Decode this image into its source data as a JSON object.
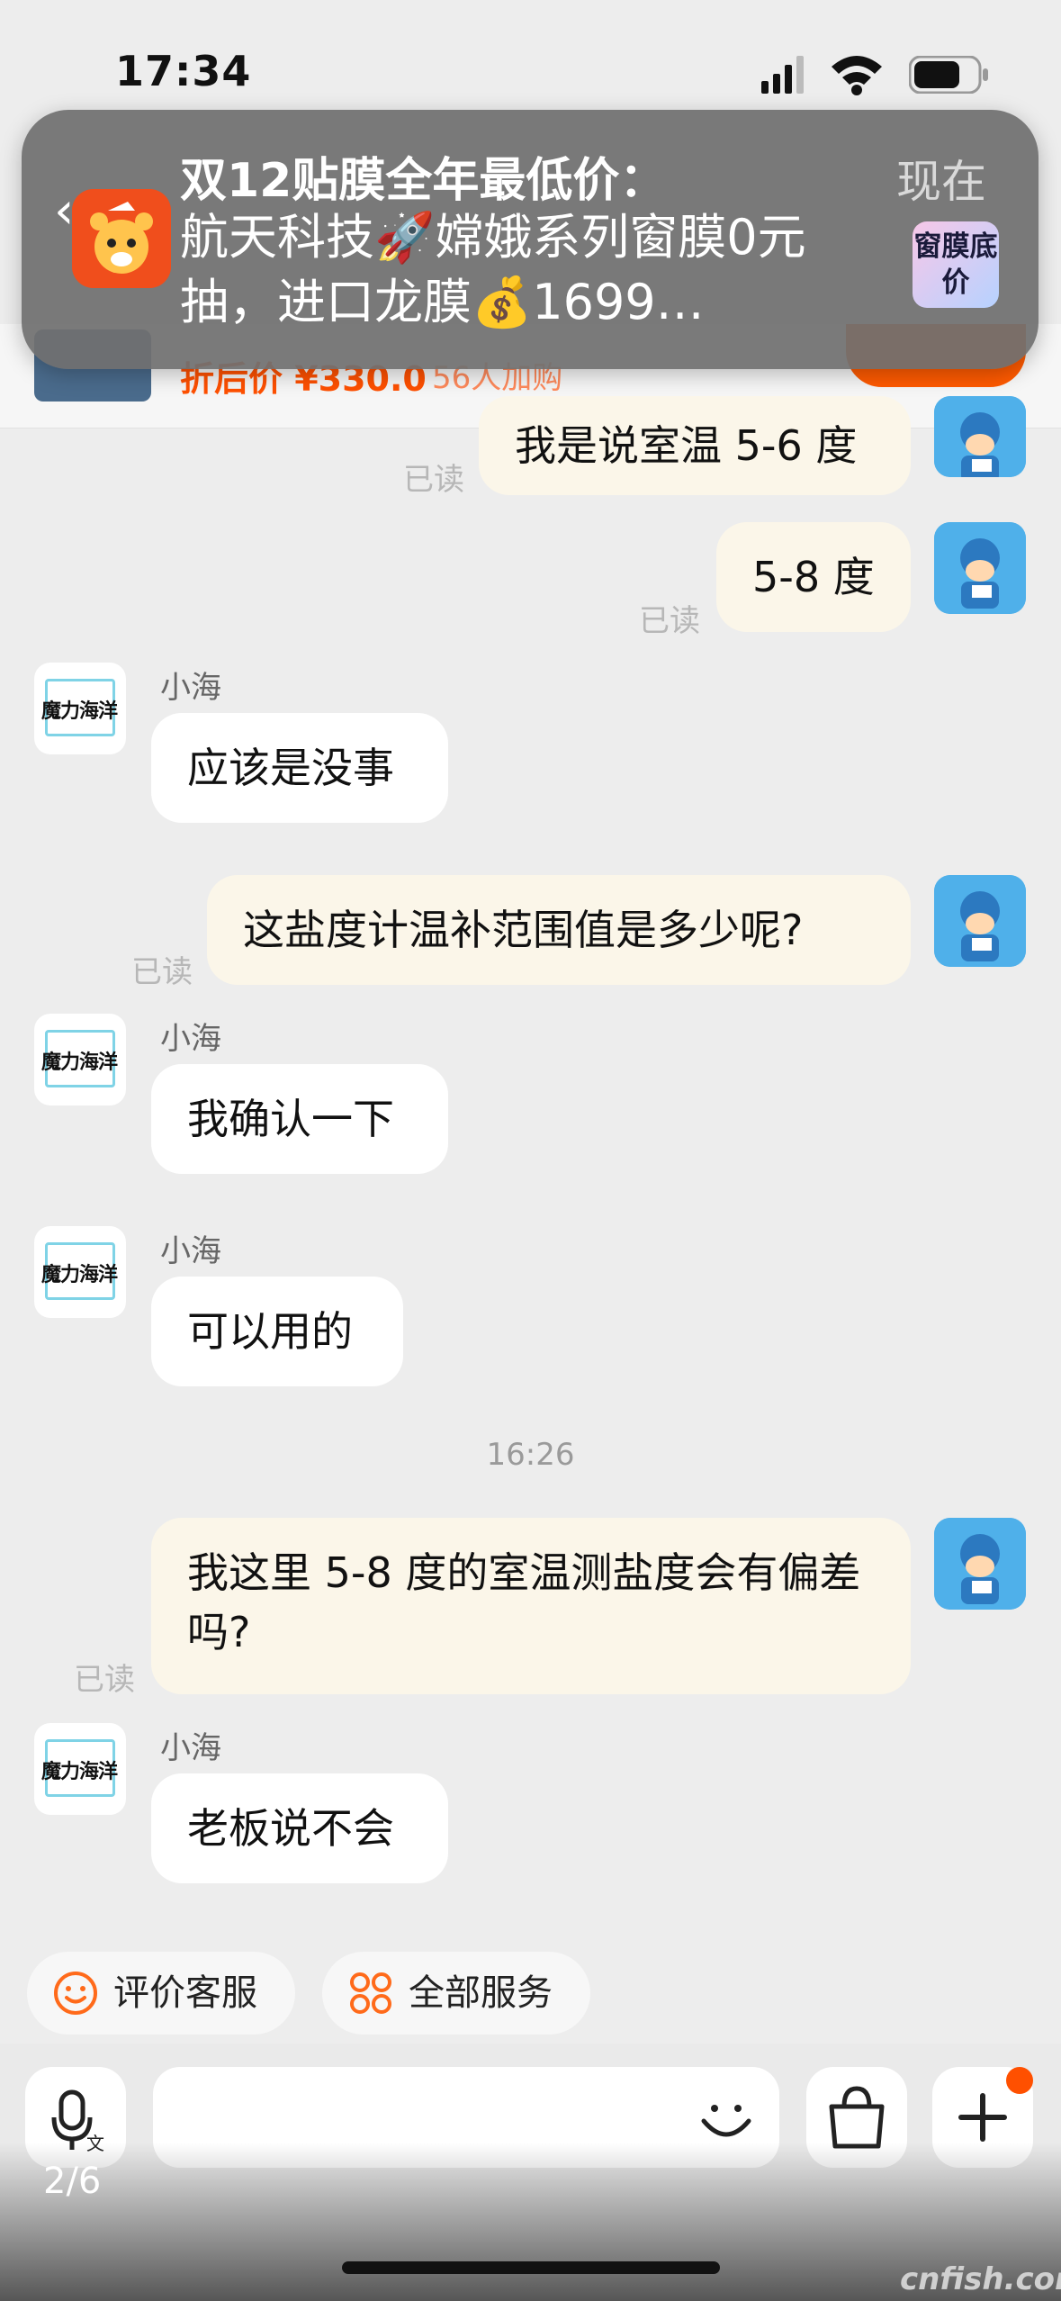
{
  "status_bar": {
    "time": "17:34"
  },
  "notification": {
    "title": "双12贴膜全年最低价：",
    "body": "航天科技🚀嫦娥系列窗膜0元抽，进口龙膜💰1699…",
    "time": "现在",
    "thumb_label": "窗膜底价",
    "app_icon": "tiger-face-icon"
  },
  "product": {
    "price": "折后价 ¥330.0",
    "cart_count": "56人加购"
  },
  "messages": [
    {
      "side": "me",
      "text": "我是说室温 5-6 度",
      "read": "已读"
    },
    {
      "side": "me",
      "text": "5-8 度",
      "read": "已读"
    },
    {
      "side": "them",
      "sender": "小海",
      "text": "应该是没事",
      "avatar_text": "魔力海洋"
    },
    {
      "side": "me",
      "text": "这盐度计温补范围值是多少呢?",
      "read": "已读"
    },
    {
      "side": "them",
      "sender": "小海",
      "text": "我确认一下",
      "avatar_text": "魔力海洋"
    },
    {
      "side": "them",
      "sender": "小海",
      "text": "可以用的",
      "avatar_text": "魔力海洋"
    },
    {
      "side": "me",
      "text": "我这里 5-8 度的室温测盐度会有偏差吗?",
      "read": "已读"
    },
    {
      "side": "them",
      "sender": "小海",
      "text": "老板说不会",
      "avatar_text": "魔力海洋"
    }
  ],
  "timestamp": "16:26",
  "quick_actions": [
    {
      "label": "评价客服",
      "icon": "smile-face-icon"
    },
    {
      "label": "全部服务",
      "icon": "grid-services-icon"
    }
  ],
  "input_bar": {
    "placeholder": "",
    "voice_icon": "microphone-translate-icon",
    "emoji_icon": "emoji-icon",
    "shop_icon": "shopping-bag-icon",
    "plus_icon": "plus-icon"
  },
  "page_indicator": "2/6",
  "watermark": "cnfish.com",
  "colors": {
    "accent": "#ff5000",
    "my_bubble": "#fbf6e9",
    "their_bubble": "#ffffff"
  }
}
